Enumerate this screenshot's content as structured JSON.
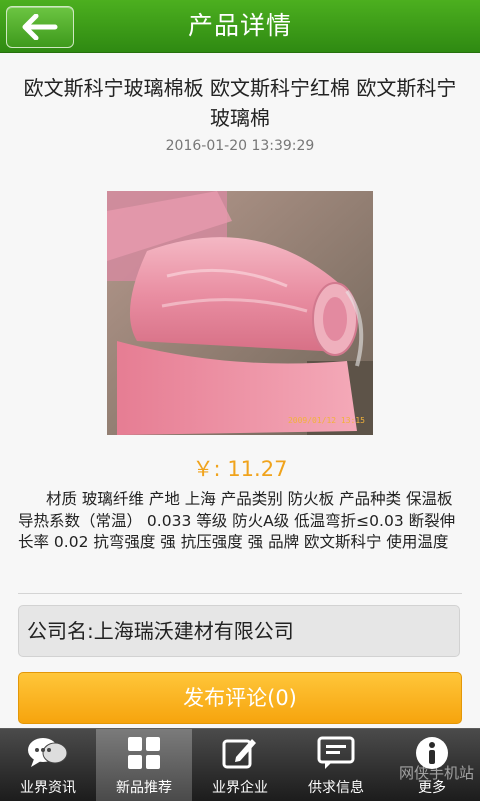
{
  "header": {
    "title": "产品详情",
    "back_icon": "back-arrow-icon"
  },
  "product": {
    "title": "欧文斯科宁玻璃棉板 欧文斯科宁红棉 欧文斯科宁玻璃棉",
    "date": "2016-01-20 13:39:29",
    "photo_timestamp": "2009/01/12 13:15",
    "price": "￥: 11.27",
    "description": "材质 玻璃纤维 产地 上海 产品类别 防火板 产品种类 保温板  导热系数（常温）  0.033 等级 防火A级 低温弯折≤0.03 断裂伸长率  0.02 抗弯强度 强 抗压强度 强 品牌 欧文斯科宁  使用温度"
  },
  "company": {
    "label": "公司名:上海瑞沃建材有限公司"
  },
  "comment_button": {
    "label": "发布评论(0)"
  },
  "tabs": [
    {
      "label": "业界资讯",
      "icon": "chat-bubbles-icon",
      "active": false
    },
    {
      "label": "新品推荐",
      "icon": "grid-icon",
      "active": true
    },
    {
      "label": "业界企业",
      "icon": "edit-icon",
      "active": false
    },
    {
      "label": "供求信息",
      "icon": "message-icon",
      "active": false
    },
    {
      "label": "更多",
      "icon": "info-icon",
      "active": false
    }
  ],
  "watermark": "网侠手机站",
  "colors": {
    "header_green": "#3a9a17",
    "price_orange": "#f0a31c",
    "button_orange": "#f6a40d",
    "tabbar_dark": "#2a2a2a"
  }
}
